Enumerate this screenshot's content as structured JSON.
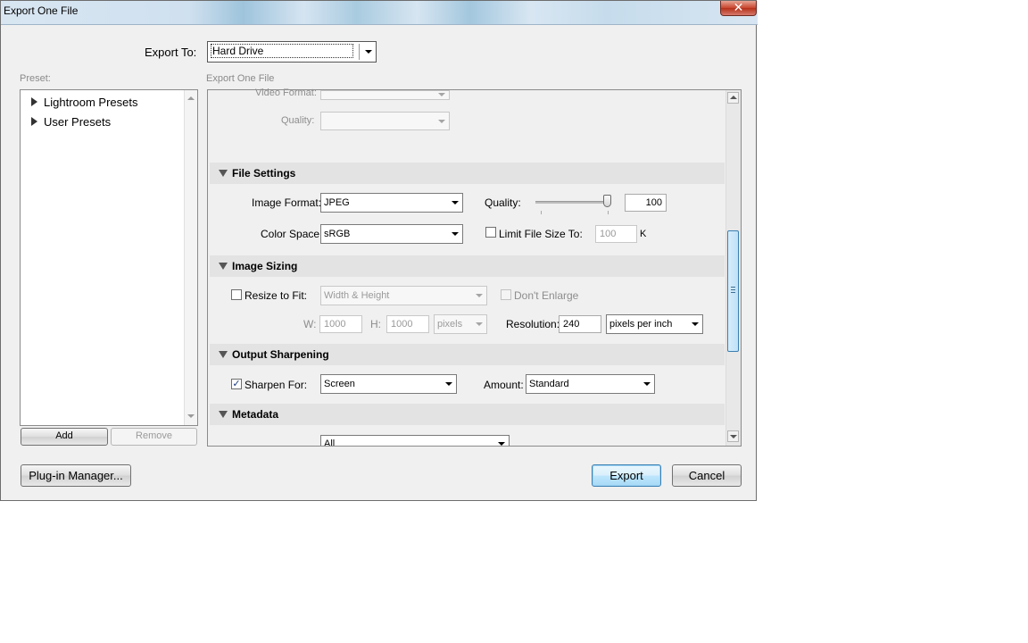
{
  "window": {
    "title": "Export One File",
    "close_glyph": "✕"
  },
  "export_to": {
    "label": "Export To:",
    "value": "Hard Drive"
  },
  "preset": {
    "label": "Preset:",
    "items": [
      "Lightroom Presets",
      "User Presets"
    ],
    "add_label": "Add",
    "remove_label": "Remove"
  },
  "panel": {
    "label": "Export One File"
  },
  "video": {
    "format_label": "Video Format:",
    "quality_label": "Quality:"
  },
  "file_settings": {
    "title": "File Settings",
    "image_format_label": "Image Format:",
    "image_format_value": "JPEG",
    "quality_label": "Quality:",
    "quality_value": "100",
    "quality_level": 1.0,
    "color_space_label": "Color Space:",
    "color_space_value": "sRGB",
    "limit_label": "Limit File Size To:",
    "limit_value": "100",
    "limit_unit": "K"
  },
  "image_sizing": {
    "title": "Image Sizing",
    "resize_label": "Resize to Fit:",
    "resize_mode": "Width & Height",
    "dont_enlarge_label": "Don't Enlarge",
    "w_label": "W:",
    "w_value": "1000",
    "h_label": "H:",
    "h_value": "1000",
    "unit": "pixels",
    "resolution_label": "Resolution:",
    "resolution_value": "240",
    "resolution_unit": "pixels per inch"
  },
  "output_sharpening": {
    "title": "Output Sharpening",
    "sharpen_label": "Sharpen For:",
    "sharpen_value": "Screen",
    "amount_label": "Amount:",
    "amount_value": "Standard",
    "checked_glyph": "✓"
  },
  "metadata": {
    "title": "Metadata",
    "value": "All"
  },
  "buttons": {
    "plugin": "Plug-in Manager...",
    "export": "Export",
    "cancel": "Cancel"
  },
  "colors": {
    "accent": "#3c7fb1",
    "section_bar": "#e3e3e3",
    "close": "#c8452d"
  }
}
